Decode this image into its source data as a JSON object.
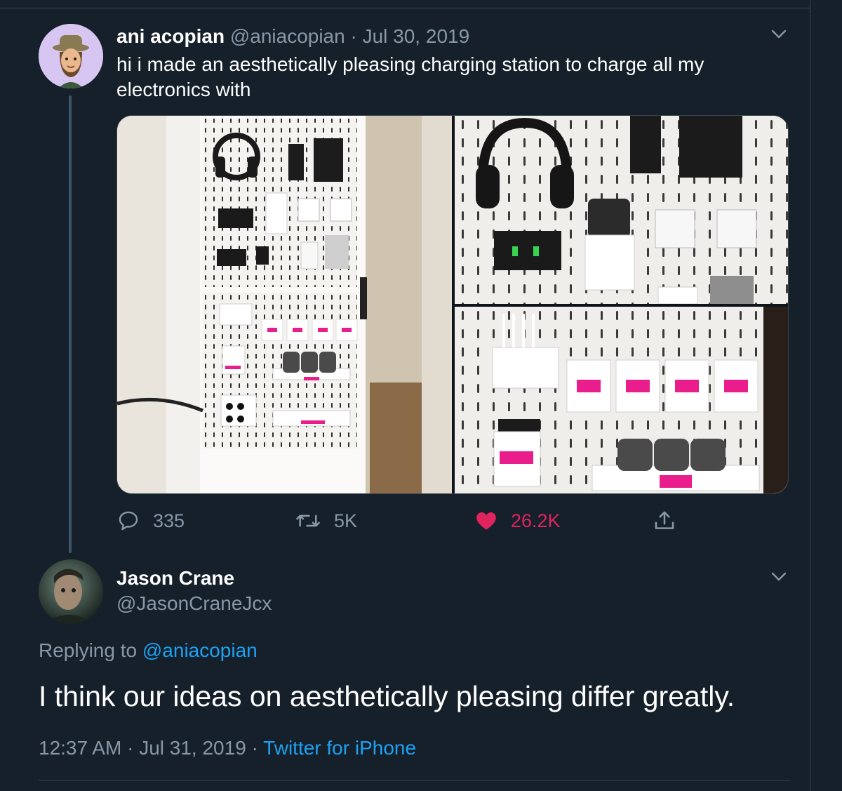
{
  "original_tweet": {
    "author_name": "ani acopian",
    "author_handle": "@aniacopian",
    "separator": "·",
    "date": "Jul 30, 2019",
    "text": "hi i made an aesthetically pleasing charging station to charge all my electronics with",
    "media_count": 3,
    "actions": {
      "reply_count": "335",
      "retweet_count": "5K",
      "like_count": "26.2K",
      "liked": true
    }
  },
  "reply_tweet": {
    "author_name": "Jason Crane",
    "author_handle": "@JasonCraneJcx",
    "replying_prefix": "Replying to",
    "replying_to": "@aniacopian",
    "text": "I think our ideas on aesthetically pleasing differ greatly.",
    "time": "12:37 AM",
    "separator1": "·",
    "date": "Jul 31, 2019",
    "separator2": "·",
    "source": "Twitter for iPhone"
  },
  "colors": {
    "background": "#15202b",
    "border": "#38444d",
    "muted_text": "#8899a6",
    "link": "#1da1f2",
    "like": "#e0245e"
  },
  "icons": [
    "reply-icon",
    "retweet-icon",
    "heart-icon",
    "share-icon",
    "chevron-down-icon"
  ]
}
